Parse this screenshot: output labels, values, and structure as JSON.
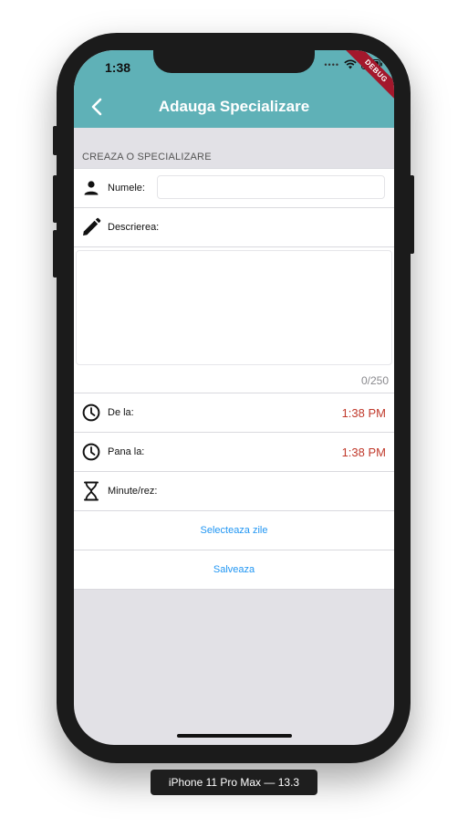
{
  "status_bar": {
    "time": "1:38",
    "debug_label": "DEBUG"
  },
  "appbar": {
    "title": "Adauga Specializare"
  },
  "section": {
    "header": "CREAZA O SPECIALIZARE"
  },
  "form": {
    "name_label": "Numele:",
    "name_value": "",
    "description_label": "Descrierea:",
    "description_value": "",
    "char_counter": "0/250",
    "from_label": "De la:",
    "from_value": "1:38 PM",
    "to_label": "Pana la:",
    "to_value": "1:38 PM",
    "minutes_label": "Minute/rez:",
    "select_days_button": "Selecteaza zile",
    "save_button": "Salveaza"
  },
  "device_label": "iPhone 11 Pro Max — 13.3",
  "colors": {
    "appbar": "#5fb1b7",
    "time_accent": "#c0392b",
    "link": "#2196f3",
    "background": "#e2e1e6"
  },
  "icons": [
    "back-arrow-icon",
    "person-icon",
    "pencil-icon",
    "clock-icon",
    "hourglass-icon",
    "wifi-icon",
    "battery-icon"
  ]
}
